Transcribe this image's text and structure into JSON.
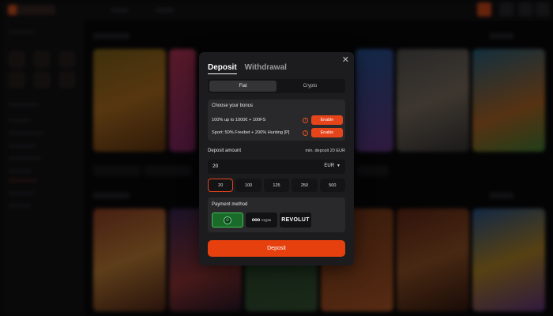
{
  "modal": {
    "tabs": [
      {
        "label": "Deposit",
        "active": true
      },
      {
        "label": "Withdrawal",
        "active": false
      }
    ],
    "close_icon": "close-icon",
    "segment": [
      {
        "label": "Fiat",
        "active": true
      },
      {
        "label": "Crypto",
        "active": false
      }
    ],
    "bonus": {
      "title": "Choose your bonus",
      "options": [
        {
          "text": "100% up to 1000€ + 100FS",
          "button": "Enable"
        },
        {
          "text": "Sport: 50% Freebet + 200% Hunting [P]",
          "button": "Enable"
        }
      ]
    },
    "amount": {
      "label": "Deposit amount",
      "min_note": "min. deposit 20 EUR",
      "value": "20",
      "currency": "EUR",
      "presets": [
        "20",
        "100",
        "125",
        "250",
        "500"
      ],
      "selected_preset": "20"
    },
    "payment": {
      "title": "Payment method",
      "methods": [
        {
          "name": "wallet",
          "icon": "wallet-icon",
          "selected": true
        },
        {
          "name": "crypto",
          "logo": "ooo",
          "sub": "Crypto",
          "selected": false
        },
        {
          "name": "revolut",
          "label": "REVOLUT",
          "selected": false
        }
      ]
    },
    "deposit_button": "Deposit"
  },
  "colors": {
    "accent": "#e6451b",
    "modal_bg": "#1c1c1e",
    "selected_method": "#1a6b2a"
  }
}
